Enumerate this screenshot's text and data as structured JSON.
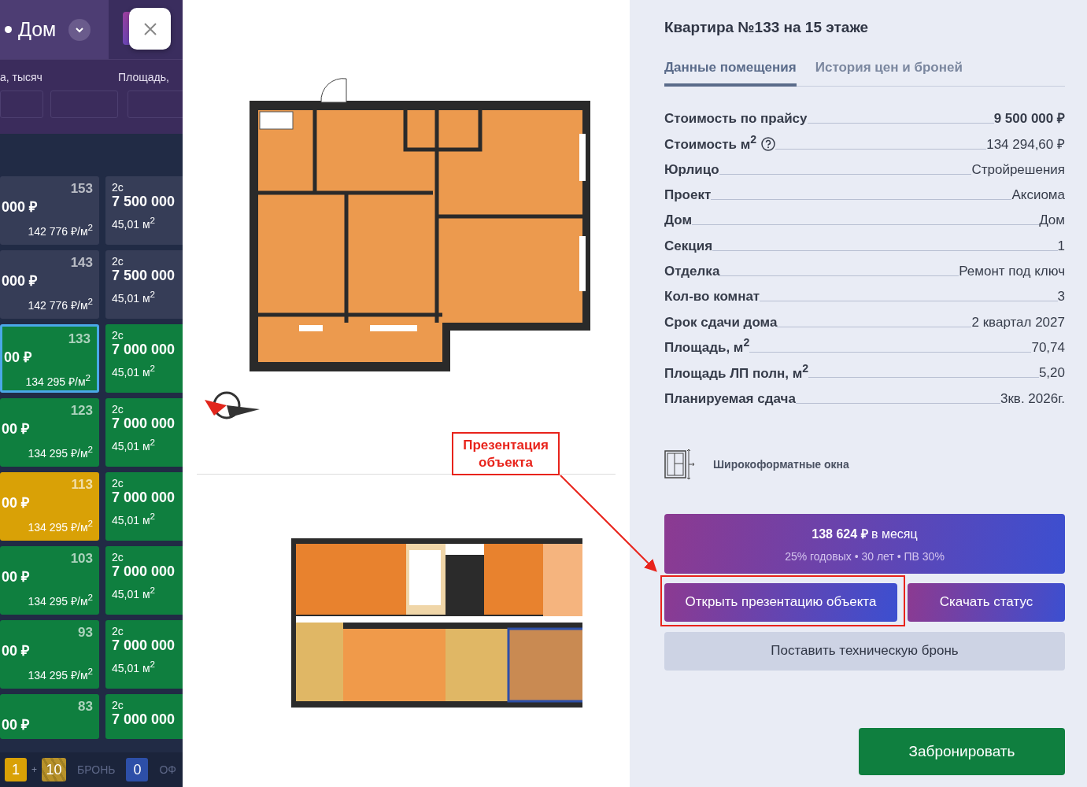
{
  "sidebar": {
    "house": "Дом",
    "filters": [
      {
        "label": "а, тысяч"
      },
      {
        "label": "Площадь,"
      }
    ],
    "cards": [
      {
        "number": "153",
        "price": "000 ₽",
        "price_per_m2": "142 776 ₽/м$^{2}$",
        "color": "#363d57",
        "selected": false
      },
      {
        "type": "2с",
        "price": "7 500 000",
        "area": "45,01 м$^{2}$",
        "color": "#363d57",
        "selected": false
      },
      {
        "number": "143",
        "price": "000 ₽",
        "price_per_m2": "142 776 ₽/м$^{2}$",
        "color": "#363d57",
        "selected": false
      },
      {
        "type": "2с",
        "price": "7 500 000",
        "area": "45,01 м$^{2}$",
        "color": "#363d57",
        "selected": false
      },
      {
        "number": "133",
        "price": "00 ₽",
        "price_per_m2": "134 295 ₽/м$^{2}$",
        "color": "#0f7f3f",
        "selected": true
      },
      {
        "type": "2с",
        "price": "7 000 000",
        "area": "45,01 м$^{2}$",
        "color": "#0f7f3f",
        "selected": false
      },
      {
        "number": "123",
        "price": "00 ₽",
        "price_per_m2": "134 295 ₽/м$^{2}$",
        "color": "#0f7f3f",
        "selected": false
      },
      {
        "type": "2с",
        "price": "7 000 000",
        "area": "45,01 м$^{2}$",
        "color": "#0f7f3f",
        "selected": false
      },
      {
        "number": "113",
        "price": "00 ₽",
        "price_per_m2": "134 295 ₽/м$^{2}$",
        "color": "#d9a106",
        "selected": false
      },
      {
        "type": "2с",
        "price": "7 000 000",
        "area": "45,01 м$^{2}$",
        "color": "#0f7f3f",
        "selected": false
      },
      {
        "number": "103",
        "price": "00 ₽",
        "price_per_m2": "134 295 ₽/м$^{2}$",
        "color": "#0f7f3f",
        "selected": false
      },
      {
        "type": "2с",
        "price": "7 000 000",
        "area": "45,01 м$^{2}$",
        "color": "#0f7f3f",
        "selected": false
      },
      {
        "number": "93",
        "price": "00 ₽",
        "price_per_m2": "134 295 ₽/м$^{2}$",
        "color": "#0f7f3f",
        "selected": false
      },
      {
        "type": "2с",
        "price": "7 000 000",
        "area": "45,01 м$^{2}$",
        "color": "#0f7f3f",
        "selected": false
      },
      {
        "number": "83",
        "price": "00 ₽",
        "color": "#0f7f3f",
        "selected": false
      },
      {
        "type": "2с",
        "price": "7 000 000",
        "color": "#0f7f3f",
        "selected": false
      }
    ],
    "legend": [
      {
        "kind": "badge",
        "text": "1",
        "color": "#d9a106"
      },
      {
        "kind": "plus",
        "text": "+"
      },
      {
        "kind": "striped",
        "text": "10",
        "color": "#b8922a"
      },
      {
        "kind": "label",
        "text": "БРОНЬ"
      },
      {
        "kind": "badge",
        "text": "0",
        "color": "#2d4fa8"
      },
      {
        "kind": "label",
        "text": "ОФ"
      }
    ]
  },
  "annotation": {
    "text": "Презентация объекта"
  },
  "details": {
    "title": "Квартира №133 на 15 этаже",
    "tabs": [
      {
        "label": "Данные помещения",
        "selected": true
      },
      {
        "label": "История цен и броней",
        "selected": false
      }
    ],
    "rows": [
      {
        "label": "Стоимость по прайсу",
        "value": "9 500 000 ₽",
        "highlight": true,
        "help": false
      },
      {
        "label": "Стоимость м$^{2}$",
        "value": "134 294,60 ₽",
        "highlight": false,
        "help": true
      },
      {
        "label": "Юрлицо",
        "value": "Стройрешения",
        "highlight": false,
        "help": false
      },
      {
        "label": "Проект",
        "value": "Аксиома",
        "highlight": false,
        "help": false
      },
      {
        "label": "Дом",
        "value": "Дом",
        "highlight": false,
        "help": false
      },
      {
        "label": "Секция",
        "value": "1",
        "highlight": false,
        "help": false
      },
      {
        "label": "Отделка",
        "value": "Ремонт под ключ",
        "highlight": false,
        "help": false
      },
      {
        "label": "Кол-во комнат",
        "value": "3",
        "highlight": false,
        "help": false
      },
      {
        "label": "Срок сдачи дома",
        "value": "2 квартал 2027",
        "highlight": false,
        "help": false
      },
      {
        "label": "Площадь, м$^{2}$",
        "value": "70,74",
        "highlight": false,
        "help": false
      },
      {
        "label": "Площадь ЛП полн, м$^{2}$",
        "value": "5,20",
        "highlight": false,
        "help": false
      },
      {
        "label": "Планируемая сдача",
        "value": "3кв. 2026г.",
        "highlight": false,
        "help": false
      }
    ],
    "features": [
      {
        "label": "Широкоформатные окна"
      }
    ],
    "mortgage": {
      "amount": "**138 624 ₽** в месяц",
      "terms": "25% годовых • 30 лет • ПВ 30%"
    },
    "buttons": [
      {
        "label": "Открыть презентацию объекта",
        "kind": "gradient"
      },
      {
        "label": "Скачать статус",
        "kind": "gradient"
      },
      {
        "label": "Поставить техническую бронь",
        "kind": "light"
      },
      {
        "label": "Забронировать",
        "kind": "primary"
      }
    ]
  }
}
